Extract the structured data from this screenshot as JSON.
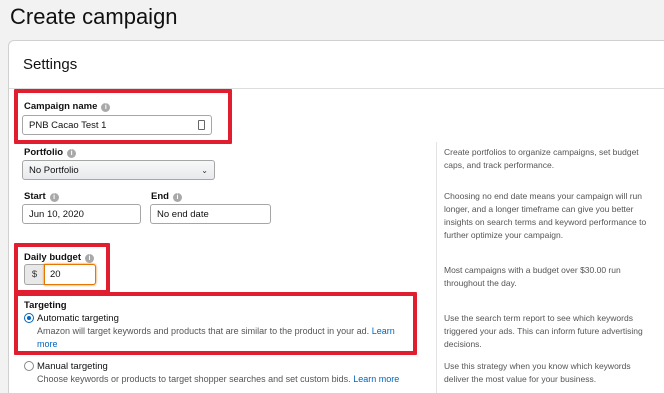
{
  "page": {
    "title": "Create campaign"
  },
  "settings": {
    "title": "Settings",
    "campaign_name": {
      "label": "Campaign name",
      "value": "PNB Cacao Test 1"
    },
    "portfolio": {
      "label": "Portfolio",
      "selected": "No Portfolio",
      "help": "Create portfolios to organize campaigns, set budget caps, and track performance."
    },
    "start": {
      "label": "Start",
      "value": "Jun 10, 2020"
    },
    "end": {
      "label": "End",
      "value": "No end date",
      "help": "Choosing no end date means your campaign will run longer, and a longer timeframe can give you better insights on search terms and keyword performance to further optimize your campaign."
    },
    "daily_budget": {
      "label": "Daily budget",
      "currency": "$",
      "value": "20",
      "help": "Most campaigns with a budget over $30.00 run throughout the day."
    },
    "targeting": {
      "label": "Targeting",
      "automatic": {
        "label": "Automatic targeting",
        "description": "Amazon will target keywords and products that are similar to the product in your ad.",
        "link": "Learn more",
        "help": "Use the search term report to see which keywords triggered your ads. This can inform future advertising decisions.",
        "selected": true
      },
      "manual": {
        "label": "Manual targeting",
        "description": "Choose keywords or products to target shopper searches and set custom bids.",
        "link": "Learn more",
        "help": "Use this strategy when you know which keywords deliver the most value for your business.",
        "selected": false
      }
    }
  },
  "colors": {
    "highlight": "#e01e2f",
    "link": "#0066c0",
    "focus": "#e77600"
  },
  "icons": {
    "info": "info-icon",
    "calendar": "calendar-icon",
    "dropdown": "chevron-down-icon"
  }
}
